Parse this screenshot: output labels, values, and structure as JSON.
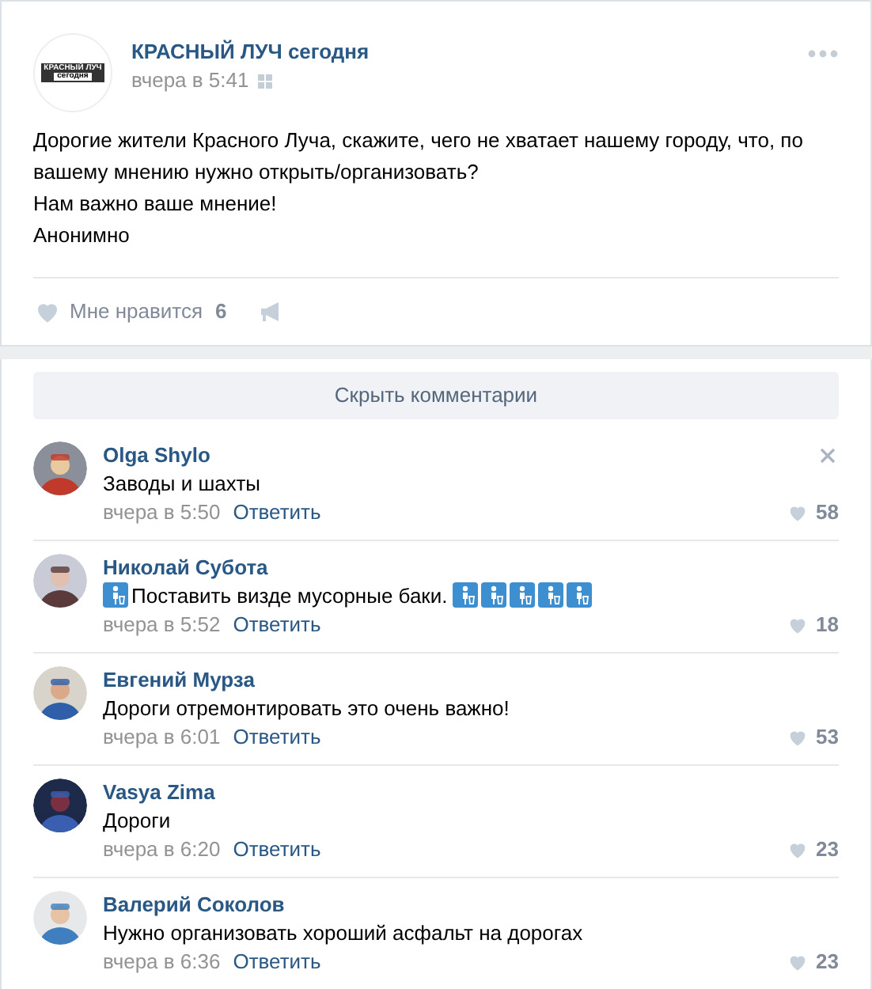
{
  "post": {
    "author": "КРАСНЫЙ ЛУЧ сегодня",
    "time": "вчера в 5:41",
    "logo": {
      "line1": "КРАСНЫЙ ЛУЧ",
      "line2": "сегодня"
    },
    "text": [
      "Дорогие жители Красного Луча, скажите, чего не хватает нашему городу, что, по вашему мнению нужно открыть/организовать?",
      "Нам важно ваше мнение!",
      "Анонимно"
    ],
    "likes": {
      "label": "Мне нравится",
      "count": "6"
    }
  },
  "hide_comments": "Скрыть комментарии",
  "comments": [
    {
      "name": "Olga Shylo",
      "body": [
        {
          "kind": "text",
          "text": "Заводы и шахты"
        }
      ],
      "time": "вчера в 5:50",
      "reply": "Ответить",
      "likes": "58",
      "show_close": true
    },
    {
      "name": "Николай Субота",
      "body": [
        {
          "kind": "emoji"
        },
        {
          "kind": "text",
          "text": "Поставить визде мусорные баки. "
        },
        {
          "kind": "emoji"
        },
        {
          "kind": "emoji"
        },
        {
          "kind": "emoji"
        },
        {
          "kind": "emoji"
        },
        {
          "kind": "emoji"
        }
      ],
      "time": "вчера в 5:52",
      "reply": "Ответить",
      "likes": "18",
      "show_close": false
    },
    {
      "name": "Евгений Мурза",
      "body": [
        {
          "kind": "text",
          "text": "Дороги отремонтировать это очень важно!"
        }
      ],
      "time": "вчера в 6:01",
      "reply": "Ответить",
      "likes": "53",
      "show_close": false
    },
    {
      "name": "Vasya Zima",
      "body": [
        {
          "kind": "text",
          "text": "Дороги"
        }
      ],
      "time": "вчера в 6:20",
      "reply": "Ответить",
      "likes": "23",
      "show_close": false
    },
    {
      "name": "Валерий Соколов",
      "body": [
        {
          "kind": "text",
          "text": "Нужно организовать хороший асфальт на дорогах"
        }
      ],
      "time": "вчера в 6:36",
      "reply": "Ответить",
      "likes": "23",
      "show_close": false
    }
  ]
}
